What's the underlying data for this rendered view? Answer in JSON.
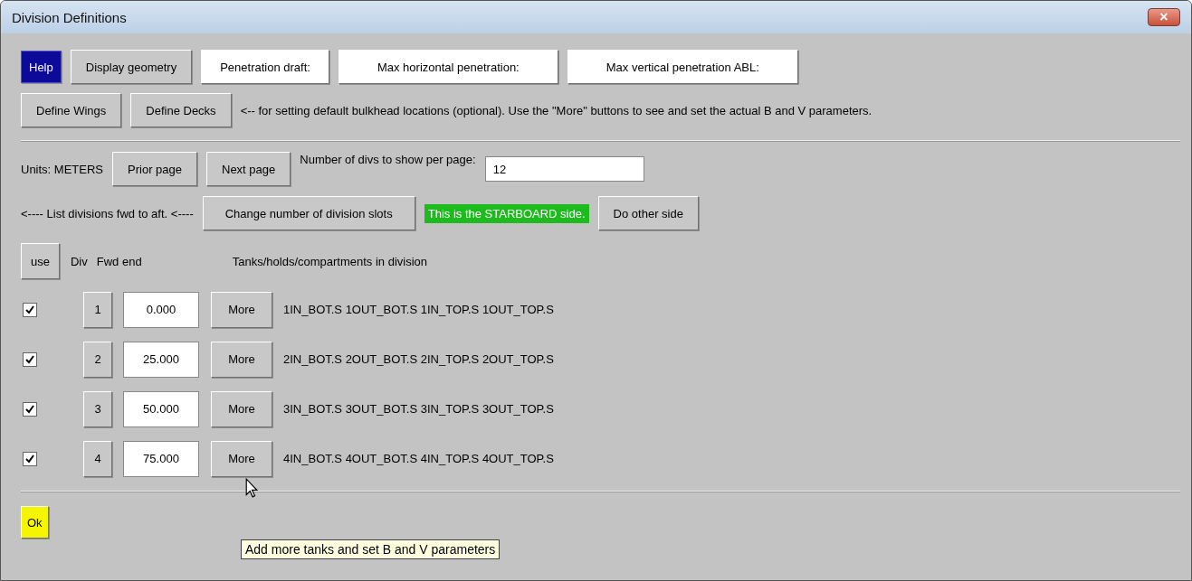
{
  "window": {
    "title": "Division Definitions",
    "close": "×"
  },
  "toolbar": [
    {
      "label": "Help",
      "kind": "blue"
    },
    {
      "label": "Display geometry",
      "kind": "grey"
    },
    {
      "label": "Penetration draft:",
      "kind": "white"
    },
    {
      "label": "Max horizontal penetration:",
      "kind": "white"
    },
    {
      "label": "Max vertical penetration ABL:",
      "kind": "white"
    }
  ],
  "define_buttons": [
    "Define Wings",
    "Define Decks"
  ],
  "define_note": "<-- for setting default bulkhead locations (optional).  Use the \"More\" buttons to see and set the actual B and V parameters.",
  "units_label": "Units: METERS",
  "page_buttons": [
    "Prior page",
    "Next page"
  ],
  "per_page_label": "Number of divs to show per page:",
  "per_page_value": "12",
  "list_note": "<---- List divisions fwd to aft. <----",
  "change_slots_button": "Change number of division slots",
  "side_label": "This is the STARBOARD side.",
  "other_side_button": "Do other side",
  "headers": {
    "use": "use",
    "div": "Div",
    "fwd_end": "Fwd end",
    "tanks": "Tanks/holds/compartments in division"
  },
  "divisions": [
    {
      "checked": true,
      "div": "1",
      "fwd_end": "0.000",
      "more": "More",
      "tanks": "1IN_BOT.S 1OUT_BOT.S 1IN_TOP.S 1OUT_TOP.S"
    },
    {
      "checked": true,
      "div": "2",
      "fwd_end": "25.000",
      "more": "More",
      "tanks": "2IN_BOT.S 2OUT_BOT.S 2IN_TOP.S 2OUT_TOP.S"
    },
    {
      "checked": true,
      "div": "3",
      "fwd_end": "50.000",
      "more": "More",
      "tanks": "3IN_BOT.S 3OUT_BOT.S 3IN_TOP.S 3OUT_TOP.S"
    },
    {
      "checked": true,
      "div": "4",
      "fwd_end": "75.000",
      "more": "More",
      "tanks": "4IN_BOT.S 4OUT_BOT.S 4IN_TOP.S 4OUT_TOP.S"
    }
  ],
  "tooltip": "Add more tanks and set B and V parameters",
  "ok_button": "Ok"
}
